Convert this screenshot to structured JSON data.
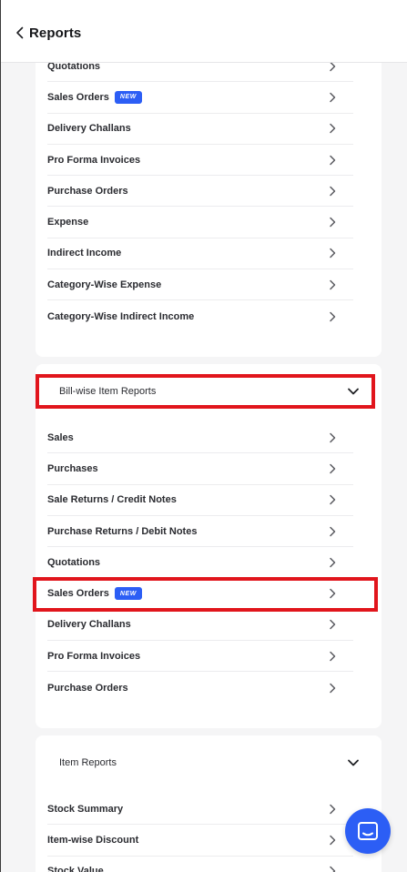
{
  "header": {
    "title": "Reports"
  },
  "colors": {
    "accent": "#2c5ef5",
    "highlight": "#e1151c"
  },
  "transaction_reports": {
    "items": [
      {
        "label": "Quotations",
        "badge": ""
      },
      {
        "label": "Sales Orders",
        "badge": "NEW"
      },
      {
        "label": "Delivery Challans",
        "badge": ""
      },
      {
        "label": "Pro Forma Invoices",
        "badge": ""
      },
      {
        "label": "Purchase Orders",
        "badge": ""
      },
      {
        "label": "Expense",
        "badge": ""
      },
      {
        "label": "Indirect Income",
        "badge": ""
      },
      {
        "label": "Category-Wise Expense",
        "badge": ""
      },
      {
        "label": "Category-Wise Indirect Income",
        "badge": ""
      }
    ]
  },
  "bill_wise": {
    "title": "Bill-wise Item Reports",
    "items": [
      {
        "label": "Sales",
        "badge": ""
      },
      {
        "label": "Purchases",
        "badge": ""
      },
      {
        "label": "Sale Returns / Credit Notes",
        "badge": ""
      },
      {
        "label": "Purchase Returns / Debit Notes",
        "badge": ""
      },
      {
        "label": "Quotations",
        "badge": ""
      },
      {
        "label": "Sales Orders",
        "badge": "NEW"
      },
      {
        "label": "Delivery Challans",
        "badge": ""
      },
      {
        "label": "Pro Forma Invoices",
        "badge": ""
      },
      {
        "label": "Purchase Orders",
        "badge": ""
      }
    ]
  },
  "item_reports": {
    "title": "Item Reports",
    "items": [
      {
        "label": "Stock Summary",
        "badge": ""
      },
      {
        "label": "Item-wise Discount",
        "badge": ""
      },
      {
        "label": "Stock Value",
        "badge": ""
      }
    ]
  }
}
